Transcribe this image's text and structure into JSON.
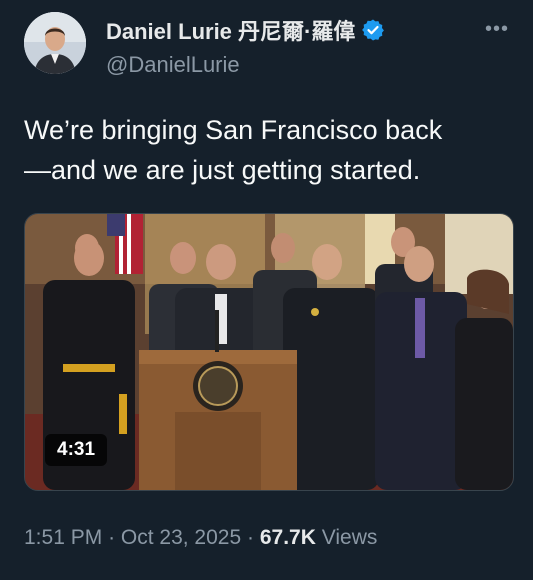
{
  "author": {
    "name": "Daniel Lurie 丹尼爾·羅偉",
    "handle": "@DanielLurie",
    "verified_color": "#1d9bf0"
  },
  "tweet": {
    "text": "We’re bringing San Francisco back\n—and we are just getting started."
  },
  "media": {
    "duration": "4:31"
  },
  "meta": {
    "time": "1:51 PM",
    "dot": "·",
    "date": "Oct 23, 2025",
    "views_count": "67.7K",
    "views_label": "Views"
  },
  "icons": {
    "more": "more-icon",
    "verified": "verified-badge-icon"
  }
}
